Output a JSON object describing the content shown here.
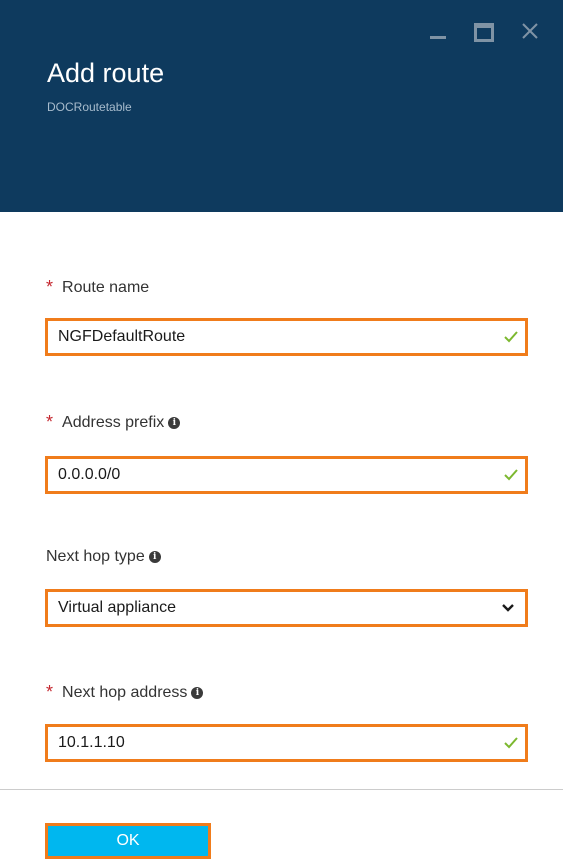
{
  "header": {
    "title": "Add route",
    "subtitle": "DOCRoutetable",
    "window_controls": [
      "minimize-icon",
      "maximize-icon",
      "close-icon"
    ]
  },
  "form": {
    "route_name": {
      "label": "Route name",
      "required": true,
      "value": "NGFDefaultRoute",
      "valid": true
    },
    "address_prefix": {
      "label": "Address prefix",
      "required": true,
      "has_info": true,
      "value": "0.0.0.0/0",
      "valid": true
    },
    "next_hop_type": {
      "label": "Next hop type",
      "required": false,
      "has_info": true,
      "selected": "Virtual appliance"
    },
    "next_hop_address": {
      "label": "Next hop address",
      "required": true,
      "has_info": true,
      "value": "10.1.1.10",
      "valid": true
    }
  },
  "actions": {
    "ok_label": "OK"
  },
  "colors": {
    "header_bg": "#0e3a5e",
    "highlight_border": "#f07c1b",
    "ok_bg": "#00b7ef",
    "valid_check": "#7cb82f",
    "required_star": "#c4262e"
  }
}
